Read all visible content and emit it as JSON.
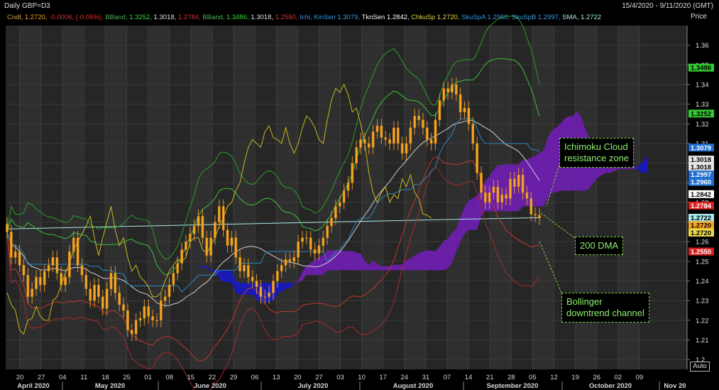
{
  "header": {
    "title": "Daily GBP=D3",
    "date_range": "15/4/2020 - 9/11/2020 (GMT)",
    "price_label": "Price",
    "auto_label": "Auto"
  },
  "legend": [
    {
      "text": "Cndl, ",
      "color": "#d6a94a"
    },
    {
      "text": "1.2720, ",
      "color": "#f0a020"
    },
    {
      "text": "-0.0006, (-0.05%), ",
      "color": "#e03030"
    },
    {
      "text": "BBand, ",
      "color": "#4caf50"
    },
    {
      "text": "1.3252, ",
      "color": "#33dd33"
    },
    {
      "text": "1.3018, ",
      "color": "#e0e0e0"
    },
    {
      "text": "1.2784, ",
      "color": "#e03030"
    },
    {
      "text": "BBand, ",
      "color": "#4caf50"
    },
    {
      "text": "1.3486, ",
      "color": "#33dd33"
    },
    {
      "text": "1.3018, ",
      "color": "#e0e0e0"
    },
    {
      "text": "1.2550, ",
      "color": "#e03030"
    },
    {
      "text": "Ichi, ",
      "color": "#3a9ad9"
    },
    {
      "text": "KinSen 1.3079, ",
      "color": "#3a9ad9"
    },
    {
      "text": "TknSen 1.2842, ",
      "color": "#ffffff"
    },
    {
      "text": "ChkuSp 1.2720, ",
      "color": "#e8d84a"
    },
    {
      "text": "SkuSpA 1.2960, ",
      "color": "#3a9ad9"
    },
    {
      "text": "SkuSpB 1.2997, ",
      "color": "#3a9ad9"
    },
    {
      "text": "SMA, 1.2722",
      "color": "#a8e8e8"
    }
  ],
  "annotations": [
    {
      "text": "Ichimoku Cloud\nresistance zone"
    },
    {
      "text": "200 DMA"
    },
    {
      "text": "Bollinger\ndowntrend channel"
    }
  ],
  "colors": {
    "background": "#000000",
    "candle_up": "#f5a623",
    "candle_down": "#f5a623",
    "cloud": "#1a1ab8",
    "cloud_bearish": "#6a1fa8",
    "bb20": "#2a9d2a",
    "bb_mid": "#cfcfcf",
    "bb_lower": "#c0392b",
    "kijun": "#2e86c1",
    "chikou": "#c8b820",
    "sma200": "#a8e8e8"
  },
  "chart_data": {
    "type": "candlestick",
    "title": "Daily GBP=D3",
    "ylabel": "Price",
    "ylim": [
      1.195,
      1.37
    ],
    "yticks": [
      1.2,
      1.21,
      1.22,
      1.23,
      1.24,
      1.25,
      1.26,
      1.27,
      1.28,
      1.29,
      1.3,
      1.31,
      1.32,
      1.33,
      1.34,
      1.35,
      1.36
    ],
    "x_day_labels": [
      "20",
      "27",
      "04",
      "11",
      "18",
      "25",
      "01",
      "08",
      "15",
      "22",
      "29",
      "06",
      "13",
      "20",
      "27",
      "03",
      "10",
      "17",
      "24",
      "31",
      "07",
      "14",
      "21",
      "28",
      "05",
      "12",
      "19",
      "26",
      "02",
      "09"
    ],
    "x_month_labels": [
      "April 2020",
      "May 2020",
      "June 2020",
      "July 2020",
      "August 2020",
      "September 2020",
      "October 2020",
      "Nov 20"
    ],
    "price_tags": [
      {
        "label": "1.3486",
        "value": 1.3486,
        "color": "#33cc33"
      },
      {
        "label": "1.3252",
        "value": 1.3252,
        "color": "#33cc33"
      },
      {
        "label": "1.3079",
        "value": 1.3079,
        "color": "#1f6fd1"
      },
      {
        "label": "1.3018",
        "value": 1.3018,
        "color": "#e6e6e6"
      },
      {
        "label": "1.3018",
        "value": 1.3018,
        "color": "#e6e6e6"
      },
      {
        "label": "1.2997",
        "value": 1.2997,
        "color": "#1f6fd1"
      },
      {
        "label": "1.2960",
        "value": 1.296,
        "color": "#1f6fd1"
      },
      {
        "label": "1.2842",
        "value": 1.2842,
        "color": "#ffffff"
      },
      {
        "label": "1.2784",
        "value": 1.2784,
        "color": "#d82020"
      },
      {
        "label": "1.2722",
        "value": 1.2722,
        "color": "#a8e8e8"
      },
      {
        "label": "1.2720",
        "value": 1.272,
        "color": "#f5a623"
      },
      {
        "label": "1.2720",
        "value": 1.272,
        "color": "#e8d84a"
      },
      {
        "label": "1.2550",
        "value": 1.255,
        "color": "#d82020"
      }
    ],
    "series": [
      {
        "name": "Cndl",
        "close": [
          1.265,
          1.252,
          1.255,
          1.248,
          1.243,
          1.232,
          1.236,
          1.242,
          1.238,
          1.245,
          1.248,
          1.252,
          1.244,
          1.238,
          1.242,
          1.255,
          1.262,
          1.248,
          1.243,
          1.236,
          1.23,
          1.238,
          1.232,
          1.226,
          1.236,
          1.244,
          1.234,
          1.228,
          1.225,
          1.215,
          1.213,
          1.22,
          1.221,
          1.227,
          1.222,
          1.22,
          1.22,
          1.23,
          1.232,
          1.238,
          1.244,
          1.249,
          1.256,
          1.26,
          1.264,
          1.268,
          1.273,
          1.262,
          1.253,
          1.262,
          1.27,
          1.278,
          1.266,
          1.258,
          1.262,
          1.252,
          1.245,
          1.248,
          1.242,
          1.24,
          1.237,
          1.232,
          1.232,
          1.234,
          1.24,
          1.245,
          1.248,
          1.251,
          1.25,
          1.252,
          1.26,
          1.262,
          1.262,
          1.256,
          1.254,
          1.258,
          1.262,
          1.268,
          1.272,
          1.278,
          1.28,
          1.286,
          1.29,
          1.3,
          1.308,
          1.312,
          1.31,
          1.308,
          1.316,
          1.319,
          1.313,
          1.312,
          1.31,
          1.318,
          1.31,
          1.305,
          1.31,
          1.318,
          1.324,
          1.322,
          1.318,
          1.312,
          1.31,
          1.322,
          1.332,
          1.338,
          1.336,
          1.34,
          1.335,
          1.326,
          1.328,
          1.32,
          1.31,
          1.295,
          1.285,
          1.28,
          1.285,
          1.288,
          1.28,
          1.284,
          1.282,
          1.292,
          1.288,
          1.294,
          1.285,
          1.282,
          1.274,
          1.2735,
          1.272
        ],
        "color": "#f5a623"
      },
      {
        "name": "BBand upper (20,2)",
        "color": "#2a9d2a"
      },
      {
        "name": "BBand middle (20)",
        "color": "#cfcfcf"
      },
      {
        "name": "BBand lower (20,2)",
        "color": "#c0392b"
      },
      {
        "name": "Ichimoku Kijun-sen",
        "color": "#2e86c1"
      },
      {
        "name": "Ichimoku Chikou span",
        "color": "#c8b820"
      },
      {
        "name": "SMA 200",
        "color": "#a8e8e8"
      }
    ]
  }
}
